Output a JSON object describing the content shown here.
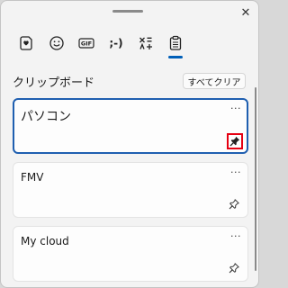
{
  "window": {
    "close_label": "✕"
  },
  "tabs": [
    {
      "icon": "heart-sticker-icon",
      "selected": false
    },
    {
      "icon": "smiley-icon",
      "selected": false
    },
    {
      "icon": "gif-icon",
      "label": "GIF",
      "selected": false
    },
    {
      "icon": "kaomoji-icon",
      "label": ";-)",
      "selected": false
    },
    {
      "icon": "symbols-icon",
      "selected": false
    },
    {
      "icon": "clipboard-icon",
      "selected": true
    }
  ],
  "clipboard": {
    "title": "クリップボード",
    "clear_all_label": "すべてクリア",
    "items": [
      {
        "text": "パソコン",
        "more_label": "···",
        "pinned": true,
        "selected": true
      },
      {
        "text": "FMV",
        "more_label": "···",
        "pinned": false,
        "selected": false
      },
      {
        "text": "My cloud",
        "more_label": "···",
        "pinned": false,
        "selected": false
      }
    ]
  },
  "colors": {
    "accent": "#005fb8",
    "highlight": "#e60012",
    "panel": "#f3f3f3"
  }
}
